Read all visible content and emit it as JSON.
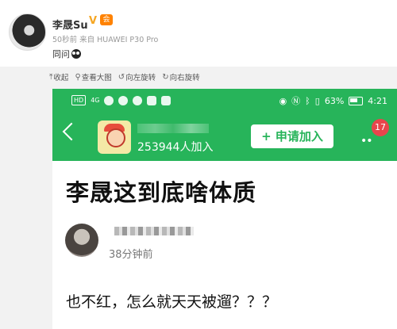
{
  "post": {
    "author": "李晟Su",
    "verified_badge": "V",
    "vip_label": "会",
    "meta": "50秒前 来自 HUAWEI P30 Pro",
    "text": "同问"
  },
  "toolbar": {
    "collapse": "收起",
    "view_large": "查看大图",
    "rotate_left": "向左旋转",
    "rotate_right": "向右旋转"
  },
  "screenshot": {
    "status_left_box": "HD",
    "signal_label": "4G",
    "battery_percent": "63%",
    "clock": "4:21",
    "member_count": "253944人加入",
    "join_button": "+ 申请加入",
    "more_label": "••",
    "unread_count": "17",
    "headline": "李晟这到底啥体质",
    "time_ago": "38分钟前",
    "body_text": "也不红，怎么就天天被遛？？？"
  },
  "colors": {
    "brand_green": "#27b45a",
    "badge_red": "#e8454c",
    "weibo_orange": "#ff8200"
  }
}
